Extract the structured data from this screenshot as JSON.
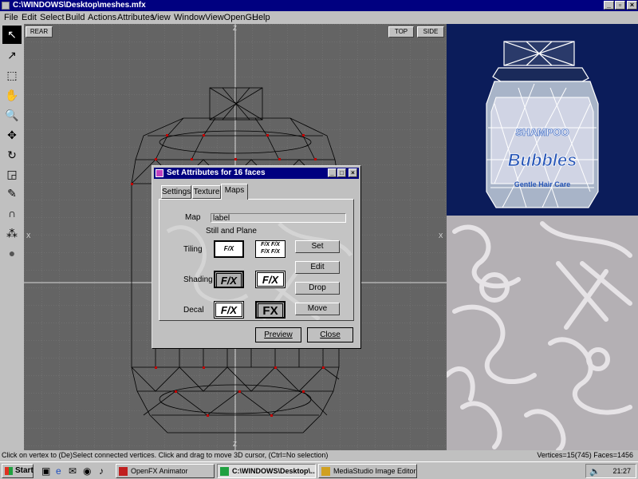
{
  "window": {
    "title": "C:\\WINDOWS\\Desktop\\meshes.mfx",
    "minimize": "_",
    "restore": "▫",
    "close": "×"
  },
  "menu": [
    "File",
    "Edit",
    "Select",
    "Build",
    "Actions",
    "Attributes",
    "View",
    "Window",
    "ViewOpenGL",
    "Help"
  ],
  "viewport": {
    "view_label": "REAR",
    "buttons": [
      "TOP",
      "SIDE"
    ],
    "axis_marks": {
      "top": "Z",
      "bottom": "Z",
      "left": "X",
      "right": "X"
    }
  },
  "tools": [
    {
      "name": "select-arrow-icon",
      "glyph": "↖"
    },
    {
      "name": "pointer-icon",
      "glyph": "↗"
    },
    {
      "name": "box-select-icon",
      "glyph": "⬚"
    },
    {
      "name": "hand-icon",
      "glyph": "✋"
    },
    {
      "name": "zoom-icon",
      "glyph": "🔍"
    },
    {
      "name": "move-icon",
      "glyph": "✥"
    },
    {
      "name": "rotate-icon",
      "glyph": "↻"
    },
    {
      "name": "scale-icon",
      "glyph": "◲"
    },
    {
      "name": "pen-icon",
      "glyph": "✎"
    },
    {
      "name": "magnet-icon",
      "glyph": "∩"
    },
    {
      "name": "spheres-icon",
      "glyph": "⁂"
    },
    {
      "name": "sphere-icon",
      "glyph": "●"
    }
  ],
  "dialog": {
    "title": "Set Attributes for 16 faces",
    "tabs": [
      "Settings",
      "Texture",
      "Maps"
    ],
    "map_label": "Map",
    "map_value": "label",
    "map_type": "Still and Plane",
    "tiling_label": "Tiling",
    "shading_label": "Shading",
    "decal_label": "Decal",
    "fx_text": "F/X",
    "fx_text_bold": "FX",
    "buttons": {
      "set": "Set",
      "edit": "Edit",
      "drop": "Drop",
      "move": "Move",
      "preview": "Preview",
      "close": "Close"
    }
  },
  "render": {
    "label_top": "SHAMPOO",
    "label_main": "Bubbles",
    "label_bottom": "Gentle Hair Care"
  },
  "status": {
    "message": "Click on vertex to (De)Select connected vertices. Click and drag to move 3D cursor, (Ctrl=No selection)",
    "counts": "Vertices=15(745) Faces=1456"
  },
  "taskbar": {
    "start": "Start",
    "tasks": [
      "OpenFX Animator",
      "C:\\WINDOWS\\Desktop\\...",
      "MediaStudio Image Editor"
    ],
    "clock": "21:27"
  }
}
